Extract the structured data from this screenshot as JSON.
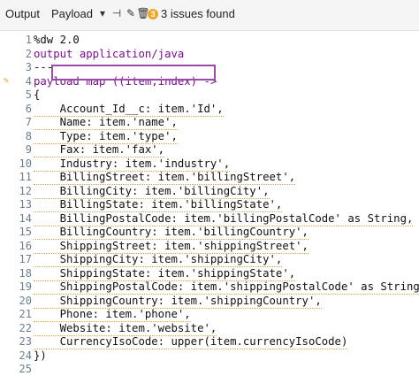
{
  "toolbar": {
    "output_label": "Output",
    "payload_label": "Payload",
    "dropdown_icon": "chevron-down-icon",
    "pin_icon": "pin-icon",
    "edit_icon": "pencil-icon",
    "delete_icon": "trash-icon",
    "warning_badge": "3",
    "issues_text": "3 issues found"
  },
  "editor": {
    "line_numbers": [
      "1",
      "2",
      "3",
      "4",
      "5",
      "6",
      "7",
      "8",
      "9",
      "10",
      "11",
      "12",
      "13",
      "14",
      "15",
      "16",
      "17",
      "18",
      "19",
      "20",
      "21",
      "22",
      "23",
      "24",
      "25"
    ],
    "lines": [
      "%dw 2.0",
      "output application/java",
      "---",
      "payload map ((item,index) ->",
      "{",
      "    Account_Id__c: item.'Id',",
      "    Name: item.'name',",
      "    Type: item.'type',",
      "    Fax: item.'fax',",
      "    Industry: item.'industry',",
      "    BillingStreet: item.'billingStreet',",
      "    BillingCity: item.'billingCity',",
      "    BillingState: item.'billingState',",
      "    BillingPostalCode: item.'billingPostalCode' as String,",
      "    BillingCountry: item.'billingCountry',",
      "    ShippingStreet: item.'shippingStreet',",
      "    ShippingCity: item.'shippingCity',",
      "    ShippingState: item.'shippingState',",
      "    ShippingPostalCode: item.'shippingPostalCode' as String,",
      "    ShippingCountry: item.'shippingCountry',",
      "    Phone: item.'phone',",
      "    Website: item.'website',",
      "    CurrencyIsoCode: upper(item.currencyIsoCode)",
      "})",
      ""
    ]
  },
  "colors": {
    "keyword": "#7a0e8d",
    "string": "#2d1ea6",
    "highlight_border": "#9b4aa8",
    "warning": "#f0a821"
  }
}
